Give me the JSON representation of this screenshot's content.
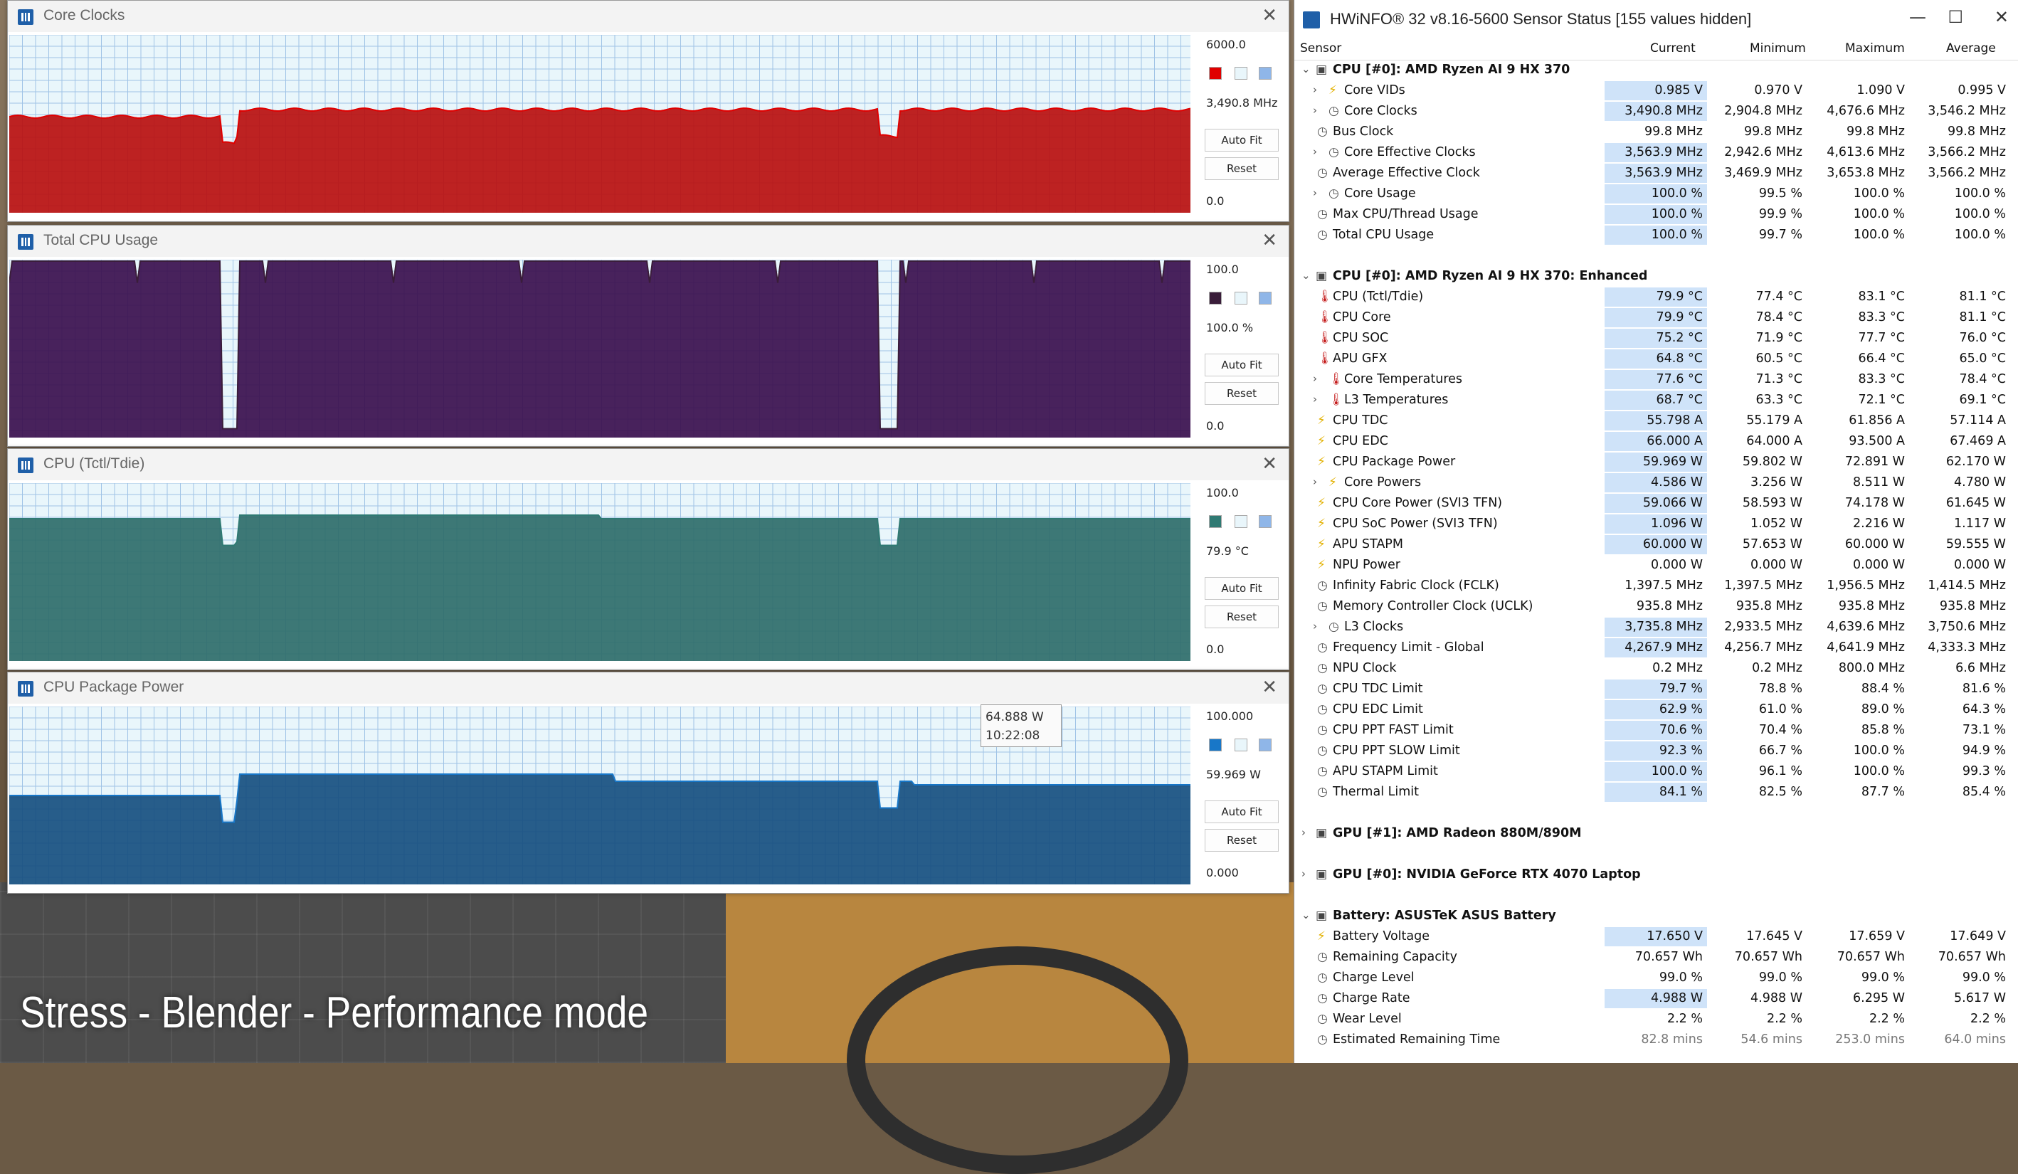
{
  "caption": "Stress - Blender - Performance mode",
  "graphs": [
    {
      "title": "Core Clocks",
      "max": "6000.0",
      "current": "3,490.8 MHz",
      "min": "0.0",
      "color": "#b80f0f",
      "swatch": "#e00000",
      "fill_level": 0.58,
      "auto_fit": "Auto Fit",
      "reset": "Reset"
    },
    {
      "title": "Total CPU Usage",
      "max": "100.0",
      "current": "100.0 %",
      "min": "0.0",
      "color": "#3a0f4e",
      "swatch": "#3a1d3a",
      "fill_level": 1.0,
      "auto_fit": "Auto Fit",
      "reset": "Reset"
    },
    {
      "title": "CPU (Tctl/Tdie)",
      "max": "100.0",
      "current": "79.9 °C",
      "min": "0.0",
      "color": "#2e6d6a",
      "swatch": "#2f7a73",
      "fill_level": 0.8,
      "auto_fit": "Auto Fit",
      "reset": "Reset"
    },
    {
      "title": "CPU Package Power",
      "max": "100.000",
      "current": "59.969 W",
      "min": "0.000",
      "color": "#164f80",
      "swatch": "#1877c8",
      "fill_level": 0.6,
      "auto_fit": "Auto Fit",
      "reset": "Reset"
    }
  ],
  "tooltip": {
    "value": "64.888 W",
    "time": "10:22:08"
  },
  "hwinfo": {
    "title": "HWiNFO® 32 v8.16-5600 Sensor Status [155 values hidden]",
    "columns": {
      "sensor": "Sensor",
      "current": "Current",
      "minimum": "Minimum",
      "maximum": "Maximum",
      "average": "Average"
    },
    "rows": [
      {
        "type": "group",
        "name": "CPU [#0]: AMD Ryzen AI 9 HX 370"
      },
      {
        "name": "Core VIDs",
        "icon": "bolt",
        "exp": true,
        "indent": 1,
        "cur": "0.985 V",
        "min": "0.970 V",
        "max": "1.090 V",
        "avg": "0.995 V",
        "hl": true
      },
      {
        "name": "Core Clocks",
        "icon": "clock",
        "exp": true,
        "indent": 1,
        "cur": "3,490.8 MHz",
        "min": "2,904.8 MHz",
        "max": "4,676.6 MHz",
        "avg": "3,546.2 MHz",
        "hl": true
      },
      {
        "name": "Bus Clock",
        "icon": "clock",
        "cur": "99.8 MHz",
        "min": "99.8 MHz",
        "max": "99.8 MHz",
        "avg": "99.8 MHz"
      },
      {
        "name": "Core Effective Clocks",
        "icon": "clock",
        "exp": true,
        "indent": 1,
        "cur": "3,563.9 MHz",
        "min": "2,942.6 MHz",
        "max": "4,613.6 MHz",
        "avg": "3,566.2 MHz",
        "hl": true
      },
      {
        "name": "Average Effective Clock",
        "icon": "clock",
        "cur": "3,563.9 MHz",
        "min": "3,469.9 MHz",
        "max": "3,653.8 MHz",
        "avg": "3,566.2 MHz",
        "hl": true
      },
      {
        "name": "Core Usage",
        "icon": "clock",
        "exp": true,
        "indent": 1,
        "cur": "100.0 %",
        "min": "99.5 %",
        "max": "100.0 %",
        "avg": "100.0 %",
        "hl": true
      },
      {
        "name": "Max CPU/Thread Usage",
        "icon": "clock",
        "cur": "100.0 %",
        "min": "99.9 %",
        "max": "100.0 %",
        "avg": "100.0 %",
        "hl": true
      },
      {
        "name": "Total CPU Usage",
        "icon": "clock",
        "cur": "100.0 %",
        "min": "99.7 %",
        "max": "100.0 %",
        "avg": "100.0 %",
        "hl": true
      },
      {
        "type": "gap"
      },
      {
        "type": "group",
        "name": "CPU [#0]: AMD Ryzen AI 9 HX 370: Enhanced"
      },
      {
        "name": "CPU (Tctl/Tdie)",
        "icon": "therm",
        "cur": "79.9 °C",
        "min": "77.4 °C",
        "max": "83.1 °C",
        "avg": "81.1 °C",
        "hl": true
      },
      {
        "name": "CPU Core",
        "icon": "therm",
        "cur": "79.9 °C",
        "min": "78.4 °C",
        "max": "83.3 °C",
        "avg": "81.1 °C",
        "hl": true
      },
      {
        "name": "CPU SOC",
        "icon": "therm",
        "cur": "75.2 °C",
        "min": "71.9 °C",
        "max": "77.7 °C",
        "avg": "76.0 °C",
        "hl": true
      },
      {
        "name": "APU GFX",
        "icon": "therm",
        "cur": "64.8 °C",
        "min": "60.5 °C",
        "max": "66.4 °C",
        "avg": "65.0 °C",
        "hl": true
      },
      {
        "name": "Core Temperatures",
        "icon": "therm",
        "exp": true,
        "indent": 1,
        "cur": "77.6 °C",
        "min": "71.3 °C",
        "max": "83.3 °C",
        "avg": "78.4 °C",
        "hl": true
      },
      {
        "name": "L3 Temperatures",
        "icon": "therm",
        "exp": true,
        "indent": 1,
        "cur": "68.7 °C",
        "min": "63.3 °C",
        "max": "72.1 °C",
        "avg": "69.1 °C",
        "hl": true
      },
      {
        "name": "CPU TDC",
        "icon": "bolt",
        "cur": "55.798 A",
        "min": "55.179 A",
        "max": "61.856 A",
        "avg": "57.114 A",
        "hl": true
      },
      {
        "name": "CPU EDC",
        "icon": "bolt",
        "cur": "66.000 A",
        "min": "64.000 A",
        "max": "93.500 A",
        "avg": "67.469 A",
        "hl": true
      },
      {
        "name": "CPU Package Power",
        "icon": "bolt",
        "cur": "59.969 W",
        "min": "59.802 W",
        "max": "72.891 W",
        "avg": "62.170 W",
        "hl": true
      },
      {
        "name": "Core Powers",
        "icon": "bolt",
        "exp": true,
        "indent": 1,
        "cur": "4.586 W",
        "min": "3.256 W",
        "max": "8.511 W",
        "avg": "4.780 W",
        "hl": true
      },
      {
        "name": "CPU Core Power (SVI3 TFN)",
        "icon": "bolt",
        "cur": "59.066 W",
        "min": "58.593 W",
        "max": "74.178 W",
        "avg": "61.645 W",
        "hl": true
      },
      {
        "name": "CPU SoC Power (SVI3 TFN)",
        "icon": "bolt",
        "cur": "1.096 W",
        "min": "1.052 W",
        "max": "2.216 W",
        "avg": "1.117 W",
        "hl": true
      },
      {
        "name": "APU STAPM",
        "icon": "bolt",
        "cur": "60.000 W",
        "min": "57.653 W",
        "max": "60.000 W",
        "avg": "59.555 W",
        "hl": true
      },
      {
        "name": "NPU Power",
        "icon": "bolt",
        "cur": "0.000 W",
        "min": "0.000 W",
        "max": "0.000 W",
        "avg": "0.000 W"
      },
      {
        "name": "Infinity Fabric Clock (FCLK)",
        "icon": "clock",
        "cur": "1,397.5 MHz",
        "min": "1,397.5 MHz",
        "max": "1,956.5 MHz",
        "avg": "1,414.5 MHz"
      },
      {
        "name": "Memory Controller Clock (UCLK)",
        "icon": "clock",
        "cur": "935.8 MHz",
        "min": "935.8 MHz",
        "max": "935.8 MHz",
        "avg": "935.8 MHz"
      },
      {
        "name": "L3 Clocks",
        "icon": "clock",
        "exp": true,
        "indent": 1,
        "cur": "3,735.8 MHz",
        "min": "2,933.5 MHz",
        "max": "4,639.6 MHz",
        "avg": "3,750.6 MHz",
        "hl": true
      },
      {
        "name": "Frequency Limit - Global",
        "icon": "clock",
        "cur": "4,267.9 MHz",
        "min": "4,256.7 MHz",
        "max": "4,641.9 MHz",
        "avg": "4,333.3 MHz",
        "hl": true
      },
      {
        "name": "NPU Clock",
        "icon": "clock",
        "cur": "0.2 MHz",
        "min": "0.2 MHz",
        "max": "800.0 MHz",
        "avg": "6.6 MHz"
      },
      {
        "name": "CPU TDC Limit",
        "icon": "clock",
        "cur": "79.7 %",
        "min": "78.8 %",
        "max": "88.4 %",
        "avg": "81.6 %",
        "hl": true
      },
      {
        "name": "CPU EDC Limit",
        "icon": "clock",
        "cur": "62.9 %",
        "min": "61.0 %",
        "max": "89.0 %",
        "avg": "64.3 %",
        "hl": true
      },
      {
        "name": "CPU PPT FAST Limit",
        "icon": "clock",
        "cur": "70.6 %",
        "min": "70.4 %",
        "max": "85.8 %",
        "avg": "73.1 %",
        "hl": true
      },
      {
        "name": "CPU PPT SLOW Limit",
        "icon": "clock",
        "cur": "92.3 %",
        "min": "66.7 %",
        "max": "100.0 %",
        "avg": "94.9 %",
        "hl": true
      },
      {
        "name": "APU STAPM Limit",
        "icon": "clock",
        "cur": "100.0 %",
        "min": "96.1 %",
        "max": "100.0 %",
        "avg": "99.3 %",
        "hl": true
      },
      {
        "name": "Thermal Limit",
        "icon": "clock",
        "cur": "84.1 %",
        "min": "82.5 %",
        "max": "87.7 %",
        "avg": "85.4 %",
        "hl": true
      },
      {
        "type": "gap"
      },
      {
        "type": "group",
        "name": "GPU [#1]: AMD Radeon 880M/890M",
        "collapsed": true
      },
      {
        "type": "gap"
      },
      {
        "type": "group",
        "name": "GPU [#0]: NVIDIA GeForce RTX 4070 Laptop",
        "collapsed": true
      },
      {
        "type": "gap"
      },
      {
        "type": "group",
        "name": "Battery: ASUSTeK ASUS Battery"
      },
      {
        "name": "Battery Voltage",
        "icon": "bolt",
        "cur": "17.650 V",
        "min": "17.645 V",
        "max": "17.659 V",
        "avg": "17.649 V",
        "hl": true
      },
      {
        "name": "Remaining Capacity",
        "icon": "clock",
        "cur": "70.657 Wh",
        "min": "70.657 Wh",
        "max": "70.657 Wh",
        "avg": "70.657 Wh"
      },
      {
        "name": "Charge Level",
        "icon": "clock",
        "cur": "99.0 %",
        "min": "99.0 %",
        "max": "99.0 %",
        "avg": "99.0 %"
      },
      {
        "name": "Charge Rate",
        "icon": "clock",
        "cur": "4.988 W",
        "min": "4.988 W",
        "max": "6.295 W",
        "avg": "5.617 W",
        "hl": true
      },
      {
        "name": "Wear Level",
        "icon": "clock",
        "cur": "2.2 %",
        "min": "2.2 %",
        "max": "2.2 %",
        "avg": "2.2 %"
      },
      {
        "name": "Estimated Remaining Time",
        "icon": "clock",
        "cur": "82.8 mins",
        "min": "54.6 mins",
        "max": "253.0 mins",
        "avg": "64.0 mins",
        "dim": true
      }
    ]
  }
}
